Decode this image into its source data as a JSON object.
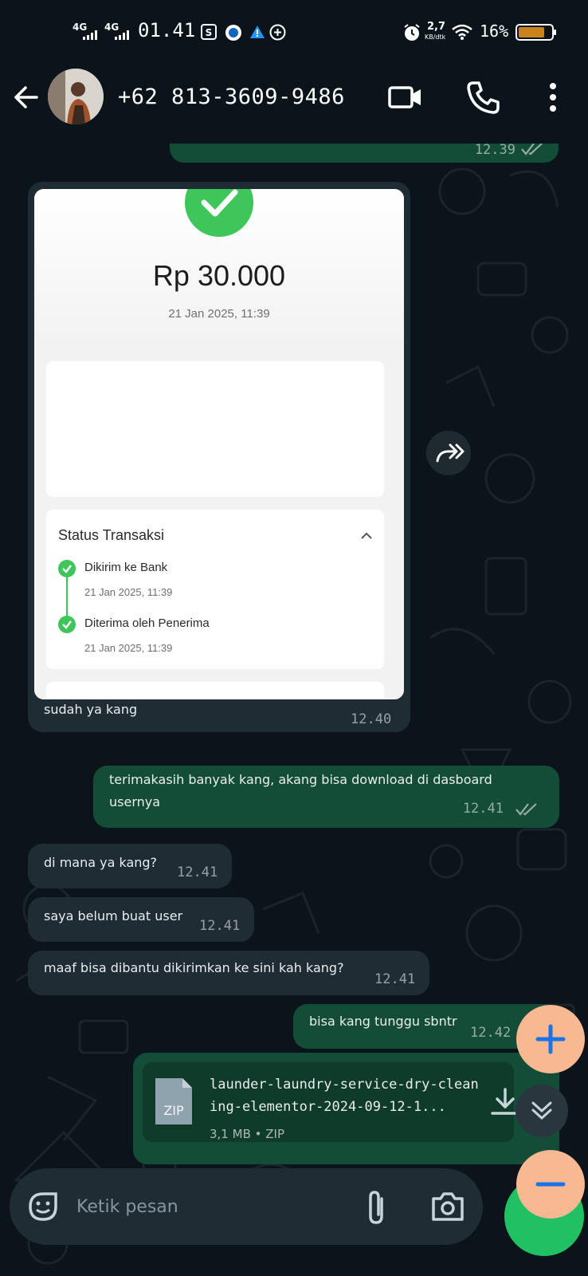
{
  "status_bar": {
    "network_1": "4G",
    "network_2": "4G",
    "time": "01.41",
    "speed_value": "2,7",
    "speed_unit": "KB/dtk",
    "battery_percent": "16%",
    "battery_level": 0.16
  },
  "header": {
    "contact_name": "+62 813-3609-9486"
  },
  "chat": {
    "prev_out_time": "12.39",
    "receipt": {
      "amount": "Rp 30.000",
      "date": "21 Jan 2025, 11:39",
      "status_title": "Status Transaksi",
      "steps": [
        {
          "label": "Dikirim ke Bank",
          "date": "21 Jan 2025, 11:39"
        },
        {
          "label": "Diterima oleh Penerima",
          "date": "21 Jan 2025, 11:39"
        }
      ],
      "caption": "sudah ya kang",
      "time": "12.40"
    },
    "messages": [
      {
        "text": "terimakasih banyak kang, akang bisa download di dasboard\nusernya",
        "time": "12.41"
      },
      {
        "text": "di mana ya kang?",
        "time": "12.41"
      },
      {
        "text": "saya belum buat user",
        "time": "12.41"
      },
      {
        "text": "maaf bisa dibantu dikirimkan ke sini kah kang?",
        "time": "12.41"
      },
      {
        "text": "bisa kang tunggu sbntr",
        "time": "12.42"
      }
    ],
    "file": {
      "badge": "ZIP",
      "name_line1": "launder-laundry-service-dry-clean",
      "name_line2": "ing-elementor-2024-09-12-1...",
      "meta": "3,1 MB • ZIP"
    }
  },
  "composer": {
    "placeholder": "Ketik pesan"
  },
  "colors": {
    "background": "#0b141a",
    "incoming_bubble": "#202c33",
    "outgoing_bubble": "#144d37",
    "zoom_fab": "#f8b891",
    "zoom_icon": "#1a73e8",
    "success_green": "#3ec65a",
    "send_button": "#21c063"
  }
}
